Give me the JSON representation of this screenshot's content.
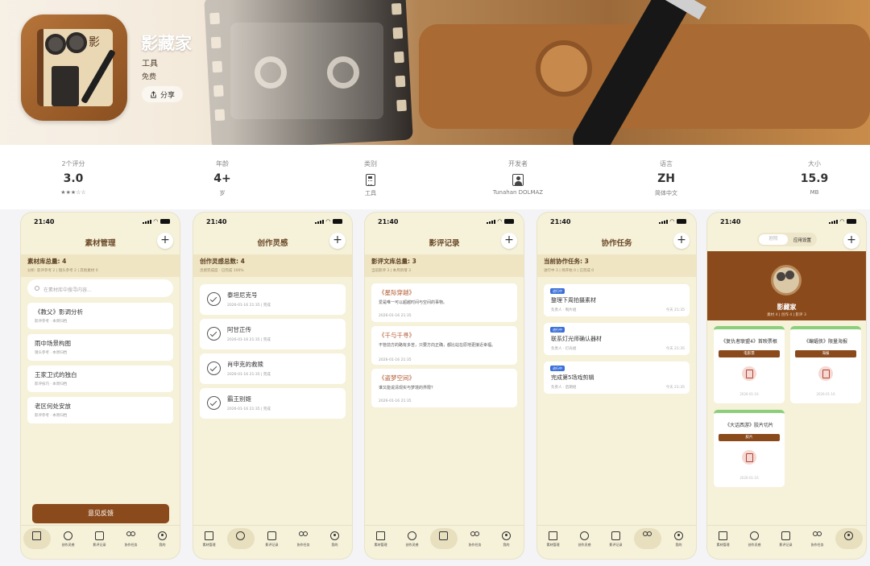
{
  "app": {
    "name": "影藏家",
    "category": "工具",
    "price": "免费",
    "share_label": "分享",
    "icon_char": "影"
  },
  "info": [
    {
      "label": "2个评分",
      "value": "3.0",
      "sub": "★★★☆☆"
    },
    {
      "label": "年龄",
      "value": "4+",
      "sub": "岁"
    },
    {
      "label": "类别",
      "value": "",
      "sub": "工具",
      "icon": "calculator-icon"
    },
    {
      "label": "开发者",
      "value": "",
      "sub": "Tunahan DOLMAZ",
      "icon": "person-icon"
    },
    {
      "label": "语言",
      "value": "ZH",
      "sub": "简体中文"
    },
    {
      "label": "大小",
      "value": "15.9",
      "sub": "MB"
    }
  ],
  "status_time": "21:40",
  "tabs": [
    "素材管理",
    "创作灵感",
    "影评记录",
    "协作任务",
    "我的"
  ],
  "screens": {
    "materials": {
      "title": "素材管理",
      "summary": "素材库总量: 4",
      "summary_sub": "分析: 影评参考 2 | 镜头参考 2 | 其他素材 0",
      "search_placeholder": "在素材库中搜寻内容...",
      "items": [
        {
          "title": "《教父》影调分析",
          "meta": "影评参考 · 本周归档"
        },
        {
          "title": "雨中场景构图",
          "meta": "镜头参考 · 本周归档"
        },
        {
          "title": "王家卫式的独白",
          "meta": "影评技巧 · 本周归档"
        },
        {
          "title": "老区何处安放",
          "meta": "影评参考 · 本周归档"
        }
      ],
      "feedback_label": "意见反馈"
    },
    "inspiration": {
      "title": "创作灵感",
      "summary": "创作灵感总数: 4",
      "summary_sub": "灵感完成度 · 已完成 100%",
      "items": [
        {
          "title": "泰坦尼克号",
          "meta": "2026-01-16 21:35 | 完成"
        },
        {
          "title": "阿甘正传",
          "meta": "2026-01-16 21:35 | 完成"
        },
        {
          "title": "肖申克的救赎",
          "meta": "2026-01-16 21:35 | 完成"
        },
        {
          "title": "霸王别姬",
          "meta": "2026-01-16 21:35 | 完成"
        }
      ]
    },
    "reviews": {
      "title": "影评记录",
      "summary": "影评文库总量: 3",
      "summary_sub": "当前影评 3 | 本月新增 3",
      "items": [
        {
          "title": "《星际穿越》",
          "body": "爱是唯一可以超越时间与空间的事物。",
          "date": "2026-01-16 21:35"
        },
        {
          "title": "《千与千寻》",
          "body": "不管前方的路有多苦，只要方向正确，都比站在原地更接近幸福。",
          "date": "2026-01-16 21:35"
        },
        {
          "title": "《盗梦空间》",
          "body": "谁又能说清现实与梦境的界限？",
          "date": "2026-01-16 21:35"
        }
      ]
    },
    "tasks": {
      "title": "协作任务",
      "summary": "当前协作任务: 3",
      "summary_sub": "进行中 3 | 待开始 0 | 已完成 0",
      "items": [
        {
          "badge": "进行中",
          "title": "整理下周拍摄素材",
          "meta": "负责人 · 制片组",
          "date": "今天 21:35"
        },
        {
          "badge": "进行中",
          "title": "联系灯光师确认器材",
          "meta": "负责人 · 灯光组",
          "date": "今天 21:35"
        },
        {
          "badge": "进行中",
          "title": "完成第5场戏剪辑",
          "meta": "负责人 · 后期组",
          "date": "今天 21:35"
        }
      ]
    },
    "profile": {
      "seg_left": "剧照",
      "seg_right": "应用设置",
      "name": "影藏家",
      "stats": "素材 4 | 创作 4 | 影评 3",
      "posters": [
        {
          "title": "《复仇者联盟4》首映票根",
          "tag": "电影票",
          "meta": "2026-01-16"
        },
        {
          "title": "《蝙蝠侠》限量海报",
          "tag": "海报",
          "meta": "2026-01-16"
        },
        {
          "title": "《大话西游》胶片切片",
          "tag": "胶片",
          "meta": "2026-01-16"
        }
      ]
    }
  }
}
